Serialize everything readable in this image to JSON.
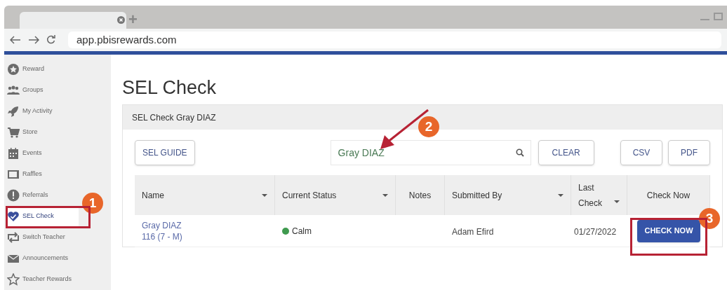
{
  "browser": {
    "url": "app.pbisrewards.com",
    "new_tab": "+"
  },
  "sidebar": {
    "items": [
      {
        "label": "Reward",
        "selected": false
      },
      {
        "label": "Groups",
        "selected": false
      },
      {
        "label": "My Activity",
        "selected": false
      },
      {
        "label": "Store",
        "selected": false
      },
      {
        "label": "Events",
        "selected": false
      },
      {
        "label": "Raffles",
        "selected": false
      },
      {
        "label": "Referrals",
        "selected": false
      },
      {
        "label": "SEL Check",
        "selected": true
      },
      {
        "label": "Switch Teacher",
        "selected": false
      },
      {
        "label": "Announcements",
        "selected": false
      },
      {
        "label": "Teacher Rewards",
        "selected": false
      }
    ]
  },
  "page": {
    "title": "SEL Check"
  },
  "card": {
    "title": "SEL Check Gray DIAZ",
    "buttons": {
      "guide": "SEL GUIDE",
      "clear": "CLEAR",
      "csv": "CSV",
      "pdf": "PDF"
    },
    "search": {
      "value": "Gray DIAZ"
    },
    "table": {
      "columns": [
        {
          "label": "Name",
          "sortable": true
        },
        {
          "label": "Current Status",
          "sortable": true
        },
        {
          "label": "Notes",
          "sortable": false
        },
        {
          "label": "Submitted By",
          "sortable": true
        },
        {
          "label": "Last Check",
          "sortable": true
        },
        {
          "label": "Check Now",
          "sortable": false
        }
      ],
      "rows": [
        {
          "name": "Gray DIAZ",
          "detail": "116 (7 - M)",
          "status": "Calm",
          "color": "#3f9a4f",
          "submitted_by": "Adam Efird",
          "last_check": "01/27/2022",
          "action": "CHECK NOW"
        }
      ]
    }
  },
  "callouts": [
    {
      "number": "1"
    },
    {
      "number": "2"
    },
    {
      "number": "3"
    }
  ]
}
